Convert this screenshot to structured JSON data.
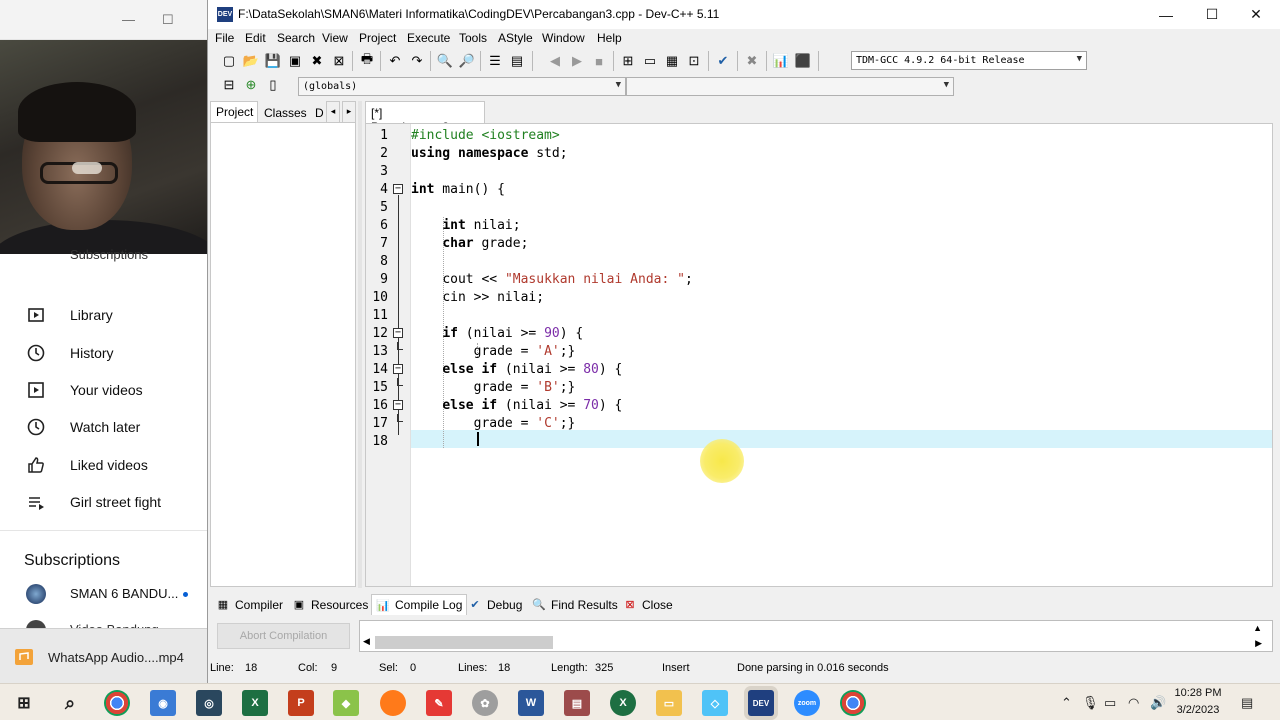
{
  "youtube": {
    "subscriptions_peek": "Subscriptions",
    "items": [
      {
        "icon": "library-icon",
        "label": "Library"
      },
      {
        "icon": "history-icon",
        "label": "History"
      },
      {
        "icon": "your-videos-icon",
        "label": "Your videos"
      },
      {
        "icon": "watch-later-icon",
        "label": "Watch later"
      },
      {
        "icon": "liked-videos-icon",
        "label": "Liked videos"
      },
      {
        "icon": "playlist-icon",
        "label": "Girl street fight"
      }
    ],
    "subscriptions_heading": "Subscriptions",
    "channel": "SMAN 6 BANDU...",
    "channel_peek": "Video Bandung"
  },
  "notification": {
    "label": "WhatsApp Audio....mp4"
  },
  "devcpp": {
    "title": "F:\\DataSekolah\\SMAN6\\Materi Informatika\\CodingDEV\\Percabangan3.cpp - Dev-C++ 5.11",
    "menus": [
      "File",
      "Edit",
      "Search",
      "View",
      "Project",
      "Execute",
      "Tools",
      "AStyle",
      "Window",
      "Help"
    ],
    "compiler": "TDM-GCC 4.9.2 64-bit Release",
    "scope_dropdown": "(globals)",
    "left_tabs": [
      "Project",
      "Classes",
      "D"
    ],
    "file_tab": "[*] Percabangan3.cpp",
    "code_lines": [
      "1",
      "2",
      "3",
      "4",
      "5",
      "6",
      "7",
      "8",
      "9",
      "10",
      "11",
      "12",
      "13",
      "14",
      "15",
      "16",
      "17",
      "18"
    ],
    "bottom_tabs": [
      "Compiler",
      "Resources",
      "Compile Log",
      "Debug",
      "Find Results",
      "Close"
    ],
    "abort_button": "Abort Compilation",
    "status": {
      "line_label": "Line:",
      "line": "18",
      "col_label": "Col:",
      "col": "9",
      "sel_label": "Sel:",
      "sel": "0",
      "lines_label": "Lines:",
      "lines": "18",
      "length_label": "Length:",
      "length": "325",
      "mode": "Insert",
      "message": "Done parsing in 0.016 seconds"
    }
  },
  "code": {
    "l1": "#include <iostream>",
    "l2_kw": "using namespace",
    "l2_rest": " std;",
    "l4_kw": "int",
    "l4_rest": " main() {",
    "l6_kw": "int",
    "l6_rest": " nilai;",
    "l7_kw": "char",
    "l7_rest": " grade;",
    "l9_a": "cout << ",
    "l9_str": "\"Masukkan nilai Anda: \"",
    "l9_b": ";",
    "l10": "cin >> nilai;",
    "l12_kw": "if",
    "l12_a": " (nilai >= ",
    "l12_num": "90",
    "l12_b": ") {",
    "l13_a": "grade = ",
    "l13_str": "'A'",
    "l13_b": ";}",
    "l14_kw": "else if",
    "l14_a": " (nilai >= ",
    "l14_num": "80",
    "l14_b": ") {",
    "l15_a": "grade = ",
    "l15_str": "'B'",
    "l15_b": ";}",
    "l16_kw": "else if",
    "l16_a": " (nilai >= ",
    "l16_num": "70",
    "l16_b": ") {",
    "l17_a": "grade = ",
    "l17_str": "'C'",
    "l17_b": ";}"
  },
  "taskbar": {
    "time": "10:28 PM",
    "date": "3/2/2023",
    "apps": [
      "windows-start-icon",
      "search-icon",
      "chrome-icon",
      "app-icon",
      "steam-icon",
      "excel-icon",
      "powerpoint-icon",
      "app-icon",
      "firefox-icon",
      "app-icon",
      "app-icon",
      "word-icon",
      "app-icon",
      "excel-icon",
      "file-explorer-icon",
      "app-icon",
      "devcpp-icon",
      "zoom-icon",
      "chrome-icon"
    ]
  },
  "colors": {
    "current_line": "#d6f3fb",
    "string": "#b03a2e",
    "number": "#7b2ca8",
    "cursor_highlight": "#f7e84a"
  }
}
